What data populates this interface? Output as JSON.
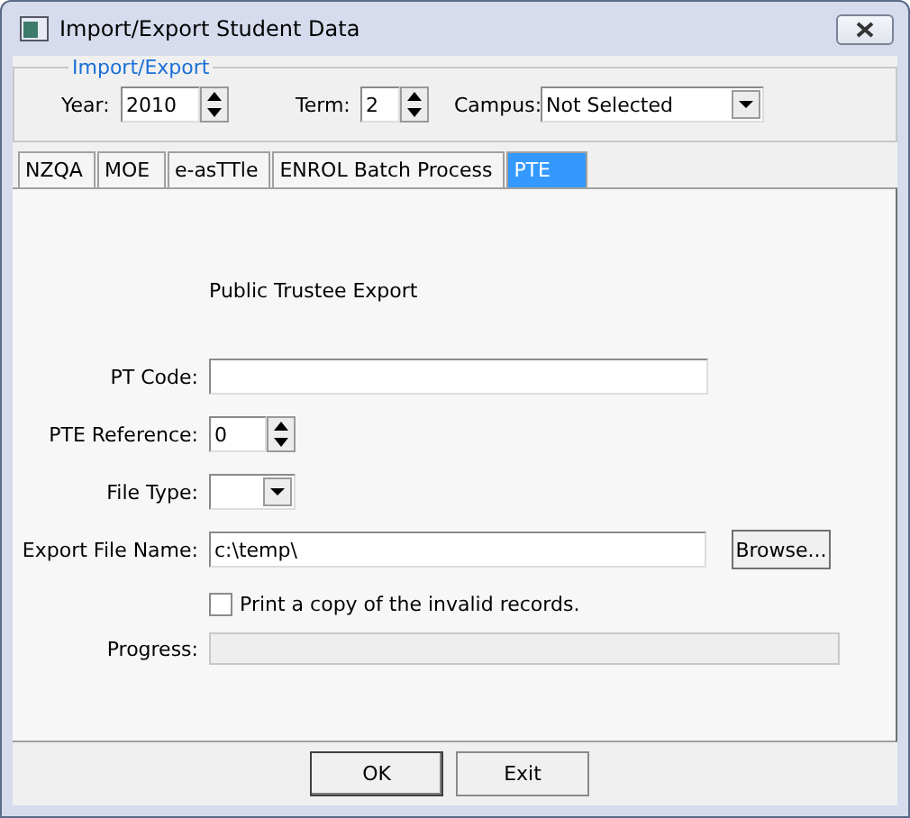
{
  "window": {
    "title": "Import/Export Student Data"
  },
  "import_export": {
    "legend": "Import/Export",
    "year": {
      "label": "Year:",
      "value": "2010"
    },
    "term": {
      "label": "Term:",
      "value": "2"
    },
    "campus": {
      "label": "Campus:",
      "value": "Not Selected"
    }
  },
  "tabs": [
    {
      "label": "NZQA",
      "selected": false
    },
    {
      "label": "MOE",
      "selected": false
    },
    {
      "label": "e-asTTle",
      "selected": false
    },
    {
      "label": "ENROL Batch Process",
      "selected": false
    },
    {
      "label": "PTE",
      "selected": true
    }
  ],
  "pte_panel": {
    "heading": "Public Trustee Export",
    "pt_code": {
      "label": "PT Code:"
    },
    "pte_reference": {
      "label": "PTE Reference:",
      "value": "0"
    },
    "file_type": {
      "label": "File Type:"
    },
    "export_file_name": {
      "label": "Export File Name:",
      "value": "c:\\temp\\",
      "browse_button": "Browse..."
    },
    "print_invalid": {
      "label": "Print a copy of the invalid records.",
      "checked": false
    },
    "progress": {
      "label": "Progress:",
      "level": 0
    }
  },
  "buttons": [
    "OK",
    "Exit"
  ]
}
